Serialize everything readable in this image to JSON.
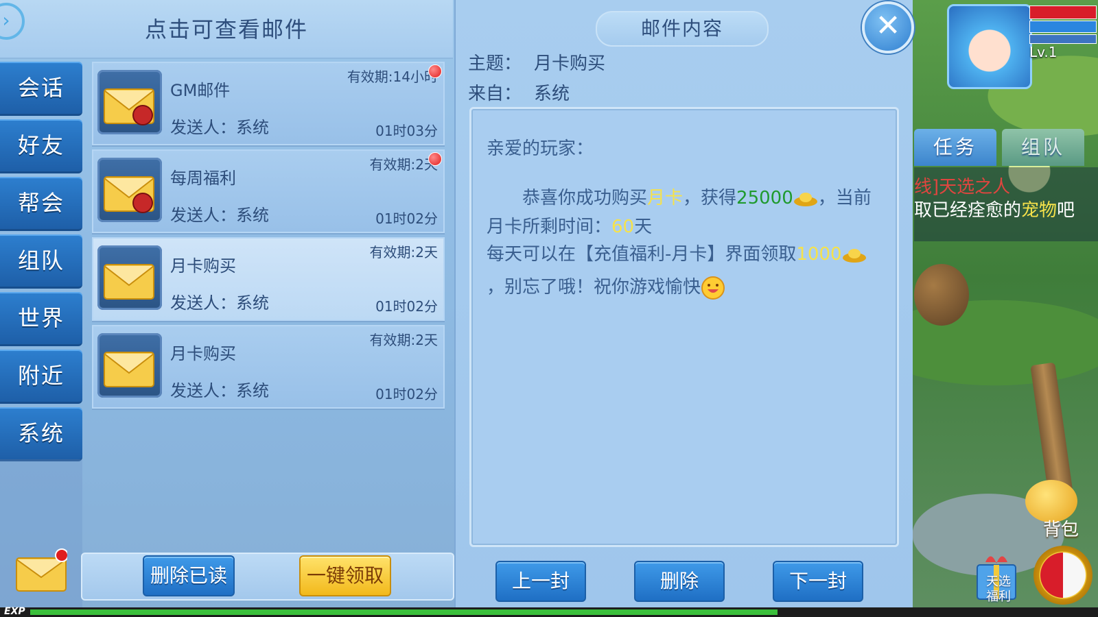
{
  "header": {
    "title": "点击可查看邮件"
  },
  "channels": [
    "会话",
    "好友",
    "帮会",
    "组队",
    "世界",
    "附近",
    "系统"
  ],
  "mails": [
    {
      "title": "GM邮件",
      "sender": "发送人：系统",
      "expire": "有效期:14小时",
      "time": "01时03分",
      "unread": true,
      "attachment": true
    },
    {
      "title": "每周福利",
      "sender": "发送人：系统",
      "expire": "有效期:2天",
      "time": "01时02分",
      "unread": true,
      "attachment": true
    },
    {
      "title": "月卡购买",
      "sender": "发送人：系统",
      "expire": "有效期:2天",
      "time": "01时02分",
      "unread": false,
      "attachment": false,
      "selected": true
    },
    {
      "title": "月卡购买",
      "sender": "发送人：系统",
      "expire": "有效期:2天",
      "time": "01时02分",
      "unread": false,
      "attachment": false
    }
  ],
  "list_buttons": {
    "delete_read": "删除已读",
    "claim_all": "一键领取"
  },
  "content": {
    "panel_title": "邮件内容",
    "subject_key": "主题：",
    "subject_val": "月卡购买",
    "from_key": "来自：",
    "from_val": "系统",
    "greeting": "亲爱的玩家：",
    "line1_a": "恭喜你成功购买",
    "line1_hl": "月卡",
    "line1_b": "，获得",
    "line1_num": "25000",
    "line1_c": "，当前",
    "line2_a": "月卡所剩时间：",
    "line2_num": "60",
    "line2_b": "天",
    "line3_a": "每天可以在【充值福利-月卡】界面领取",
    "line3_num": "1000",
    "line4": "，别忘了哦！祝你游戏愉快",
    "buttons": {
      "prev": "上一封",
      "delete": "删除",
      "next": "下一封"
    }
  },
  "hud": {
    "level": "Lv.1",
    "tabs": [
      "任务",
      "组队"
    ],
    "quest_line1": "线]天选之人",
    "quest_line2_a": "取已经痊愈的",
    "quest_line2_hl": "宠物",
    "quest_line2_b": "吧",
    "bag": "背包",
    "welfare": "天选福利"
  },
  "exp": {
    "label": "EXP",
    "fill": 0.7
  },
  "colors": {
    "highlight_yellow": "#f6e24a",
    "highlight_green": "#1f9a2e",
    "channel_blue": "#2d7fcf"
  }
}
